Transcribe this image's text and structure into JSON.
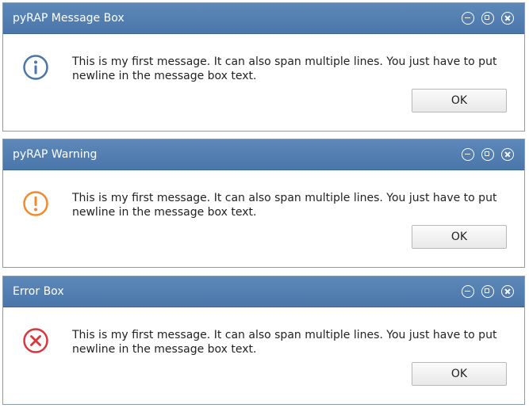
{
  "dialogs": [
    {
      "title": "pyRAP Message Box",
      "icon": "info-icon",
      "icon_color": "#4a76aa",
      "message": "This is my first message. It can also span multiple lines. You just have to put newline in the message box text.",
      "ok_label": "OK"
    },
    {
      "title": "pyRAP Warning",
      "icon": "warning-icon",
      "icon_color": "#ef8a2e",
      "message": "This is my first message. It can also span multiple lines. You just have to put newline in the message box text.",
      "ok_label": "OK"
    },
    {
      "title": "Error Box",
      "icon": "error-icon",
      "icon_color": "#d9363e",
      "message": "This is my first message. It can also span multiple lines. You just have to put newline in the message box text.",
      "ok_label": "OK"
    }
  ],
  "colors": {
    "titlebar": "#4a76aa",
    "titlebar_text": "#ffffff",
    "border": "#8a9bb0"
  }
}
